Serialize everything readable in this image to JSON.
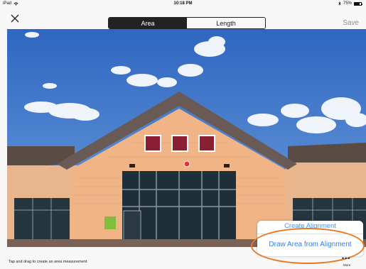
{
  "status_bar": {
    "device": "iPad",
    "wifi_icon": "wifi-icon",
    "time": "10:18 PM",
    "bluetooth_icon": "bluetooth-icon",
    "battery_percent": "75%",
    "battery_level": 0.75
  },
  "nav": {
    "close_icon": "close-icon",
    "tabs": [
      {
        "label": "Area",
        "active": true
      },
      {
        "label": "Length",
        "active": false
      }
    ],
    "save_label": "Save"
  },
  "photo": {
    "subject": "building-facade-photo"
  },
  "hint": "Tap and drag to create an area measurement",
  "popup": {
    "items": [
      {
        "label": "Create Alignment"
      },
      {
        "label": "Draw Area from Alignment"
      }
    ]
  },
  "more": {
    "icon": "more-dots-icon",
    "label": "More"
  },
  "colors": {
    "accent_blue": "#2f7ff0",
    "highlight_orange": "#e87722"
  }
}
